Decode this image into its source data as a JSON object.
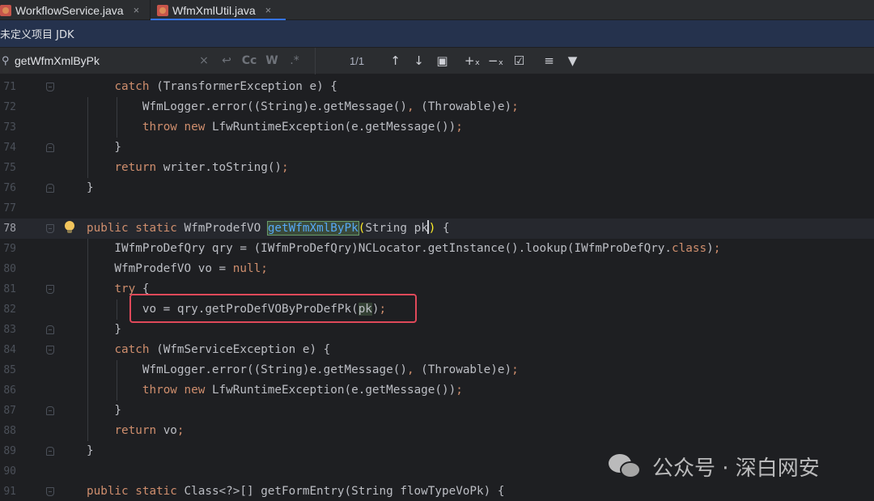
{
  "tabs": [
    {
      "label": "WorkflowService.java",
      "close": "×"
    },
    {
      "label": "WfmXmlUtil.java",
      "close": "×"
    }
  ],
  "notification": {
    "text": "未定义项目 JDK"
  },
  "search": {
    "icon": "search-icon",
    "value": "getWfmXmlByPk",
    "clear": "×",
    "replace": "↩",
    "match_case": "Cc",
    "words": "W",
    "regex": ".*",
    "match_count": "1/1",
    "prev": "↑",
    "next": "↓",
    "in_selection": "▣",
    "filter": "▼"
  },
  "editor": {
    "lines": [
      "71",
      "72",
      "73",
      "74",
      "75",
      "76",
      "77",
      "78",
      "79",
      "80",
      "81",
      "82",
      "83",
      "84",
      "85",
      "86",
      "87",
      "88",
      "89",
      "90",
      "91"
    ],
    "current_line": "78"
  },
  "watermark": {
    "text": "公众号 · 深白网安"
  }
}
